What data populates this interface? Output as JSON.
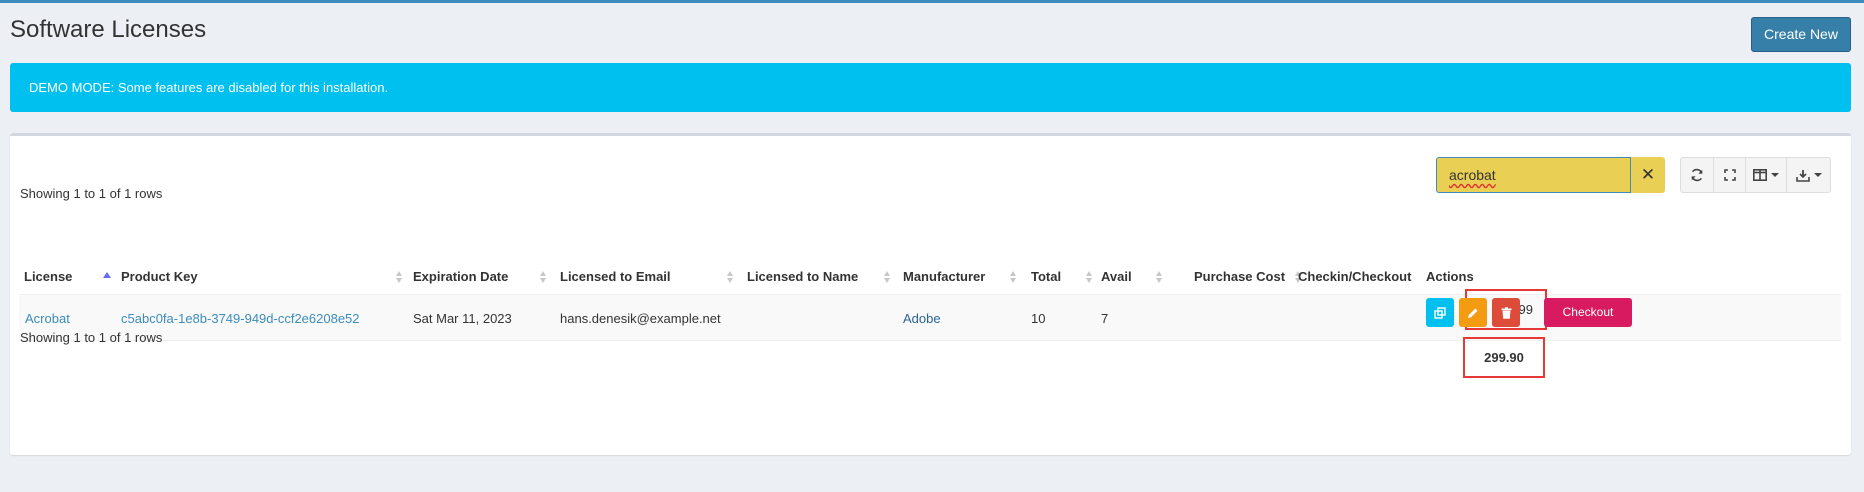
{
  "header": {
    "title": "Software Licenses",
    "create_button": "Create New"
  },
  "alert": {
    "text": "DEMO MODE: Some features are disabled for this installation."
  },
  "toolbar": {
    "search_value": "acrobat",
    "clear_symbol": "✕",
    "icons": [
      "refresh-icon",
      "fullscreen-icon",
      "columns-icon",
      "export-icon"
    ]
  },
  "pagination": {
    "top_text": "Showing 1 to 1 of 1 rows",
    "bottom_text": "Showing 1 to 1 of 1 rows"
  },
  "table": {
    "columns": {
      "license": "License",
      "product_key": "Product Key",
      "expiration_date": "Expiration Date",
      "licensed_email": "Licensed to Email",
      "licensed_name": "Licensed to Name",
      "manufacturer": "Manufacturer",
      "total": "Total",
      "avail": "Avail",
      "purchase_cost": "Purchase Cost",
      "checkin_checkout": "Checkin/Checkout",
      "actions": "Actions"
    },
    "sorted_column": "License",
    "sort_direction": "ascending",
    "rows": [
      {
        "license": "Acrobat",
        "product_key": "c5abc0fa-1e8b-3749-949d-ccf2e6208e52",
        "expiration_date": "Sat Mar 11, 2023",
        "licensed_email": "hans.denesik@example.net",
        "licensed_name": "",
        "manufacturer": "Adobe",
        "total": "10",
        "avail": "7",
        "purchase_cost": "29.99",
        "checkout_label": "Checkout"
      }
    ],
    "footer_total": "299.90"
  },
  "colors": {
    "accent": "#3c8dbc",
    "alert": "#00c0ef",
    "checkout": "#d81b60",
    "clone": "#00c0ef",
    "edit": "#f39c12",
    "delete": "#dd4b39",
    "highlight_border": "#e53935",
    "search_bg": "#e9cf53"
  }
}
